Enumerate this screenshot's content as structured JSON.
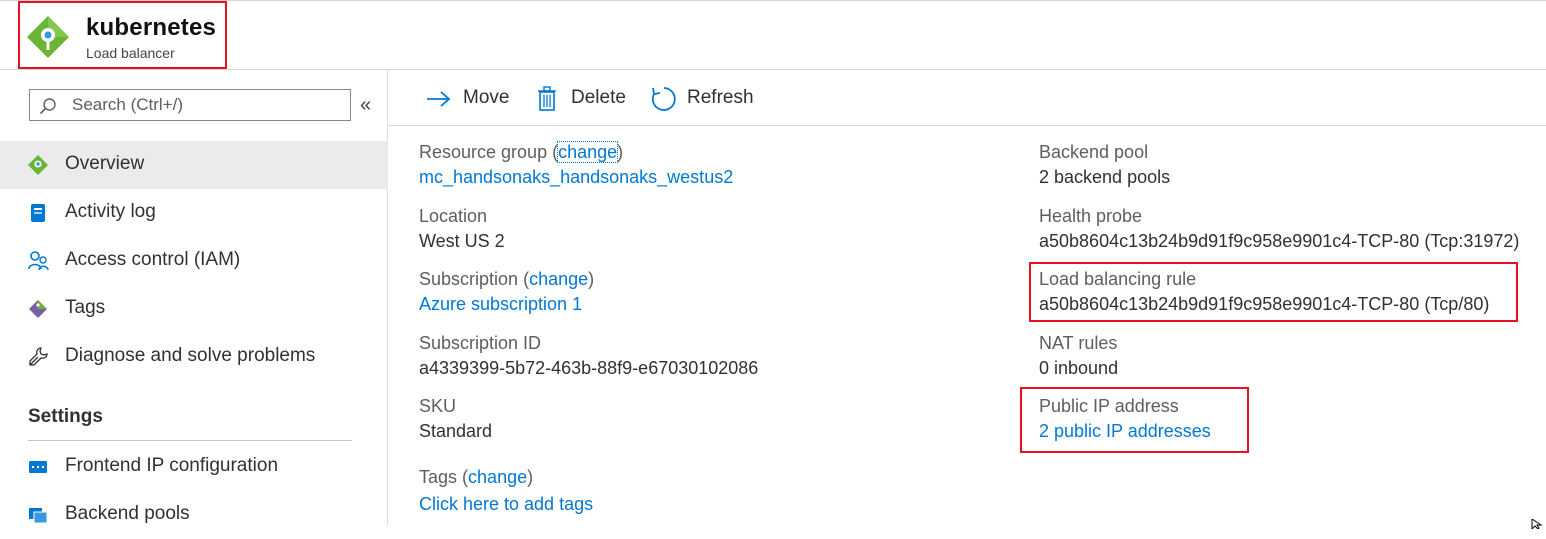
{
  "header": {
    "title": "kubernetes",
    "subtitle": "Load balancer",
    "icon": "load-balancer-icon"
  },
  "sidebar": {
    "search_placeholder": "Search (Ctrl+/)",
    "collapse_label": "«",
    "items": [
      {
        "label": "Overview",
        "icon": "overview-diamond-icon",
        "active": true
      },
      {
        "label": "Activity log",
        "icon": "activity-log-icon"
      },
      {
        "label": "Access control (IAM)",
        "icon": "people-icon"
      },
      {
        "label": "Tags",
        "icon": "tag-icon"
      },
      {
        "label": "Diagnose and solve problems",
        "icon": "wrench-icon"
      }
    ],
    "settings_title": "Settings",
    "settings_items": [
      {
        "label": "Frontend IP configuration",
        "icon": "frontend-ip-icon"
      },
      {
        "label": "Backend pools",
        "icon": "backend-pools-icon"
      }
    ]
  },
  "toolbar": {
    "move": "Move",
    "delete": "Delete",
    "refresh": "Refresh"
  },
  "essentials": {
    "left": {
      "resource_group_label": "Resource group",
      "resource_group_change": "change",
      "resource_group_value": "mc_handsonaks_handsonaks_westus2",
      "location_label": "Location",
      "location_value": "West US 2",
      "subscription_label": "Subscription",
      "subscription_change": "change",
      "subscription_value": "Azure subscription 1",
      "subscription_id_label": "Subscription ID",
      "subscription_id_value": "a4339399-5b72-463b-88f9-e67030102086",
      "sku_label": "SKU",
      "sku_value": "Standard",
      "tags_label": "Tags",
      "tags_change": "change",
      "tags_value": "Click here to add tags"
    },
    "right": {
      "backend_pool_label": "Backend pool",
      "backend_pool_value": "2 backend pools",
      "health_probe_label": "Health probe",
      "health_probe_value": "a50b8604c13b24b9d91f9c958e9901c4-TCP-80 (Tcp:31972)",
      "lb_rule_label": "Load balancing rule",
      "lb_rule_value": "a50b8604c13b24b9d91f9c958e9901c4-TCP-80 (Tcp/80)",
      "nat_rules_label": "NAT rules",
      "nat_rules_value": "0 inbound",
      "public_ip_label": "Public IP address",
      "public_ip_value": "2 public IP addresses"
    }
  },
  "colors": {
    "link": "#0078d4",
    "highlight": "#e81123",
    "brand_green": "#6bb536"
  }
}
